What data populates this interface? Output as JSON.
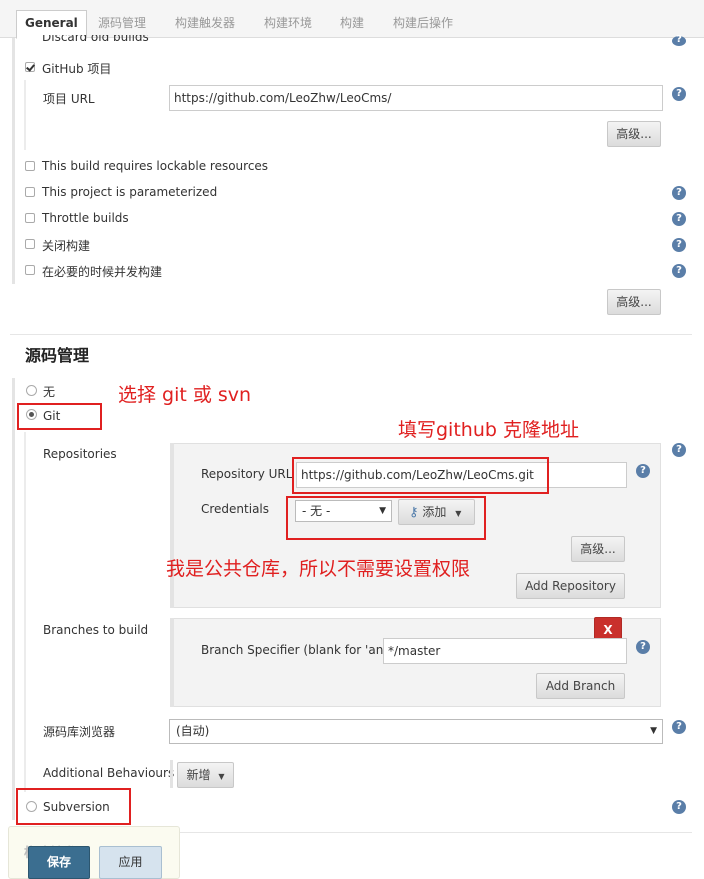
{
  "tabs": [
    "General",
    "源码管理",
    "构建触发器",
    "构建环境",
    "构建",
    "构建后操作"
  ],
  "general": {
    "discard_old_builds": "Discard old builds",
    "github_project": "GitHub 项目",
    "project_url_label": "项目 URL",
    "project_url_value": "https://github.com/LeoZhw/LeoCms/",
    "advanced": "高级...",
    "lockable": "This build requires lockable resources",
    "parameterized": "This project is parameterized",
    "throttle": "Throttle builds",
    "disable": "关闭构建",
    "concurrent": "在必要的时候并发构建",
    "help": "?"
  },
  "scm": {
    "heading": "源码管理",
    "none_option": "无",
    "git_option": "Git",
    "repositories_label": "Repositories",
    "repo_url_label": "Repository URL",
    "repo_url_value": "https://github.com/LeoZhw/LeoCms.git",
    "credentials_label": "Credentials",
    "credentials_value": "- 无 -",
    "add_button": "添加",
    "advanced": "高级...",
    "add_repository": "Add Repository",
    "branches_label": "Branches to build",
    "branch_specifier_label": "Branch Specifier (blank for 'any')",
    "branch_specifier_value": "*/master",
    "delete_button": "X",
    "add_branch": "Add Branch",
    "browser_label": "源码库浏览器",
    "browser_value": "(自动)",
    "additional_label": "Additional Behaviours",
    "new_button": "新增",
    "subversion_option": "Subversion"
  },
  "annotations": {
    "choose": "选择 git 或 svn",
    "fill": "填写github 克隆地址",
    "public": "我是公共仓库，所以不需要设置权限"
  },
  "footer": {
    "save": "保存",
    "apply": "应用",
    "hidden_text": "构建触发器"
  },
  "colors": {
    "annotation_red": "#e02020",
    "save_button": "#3b6e90",
    "apply_button": "#d6e3ee"
  }
}
